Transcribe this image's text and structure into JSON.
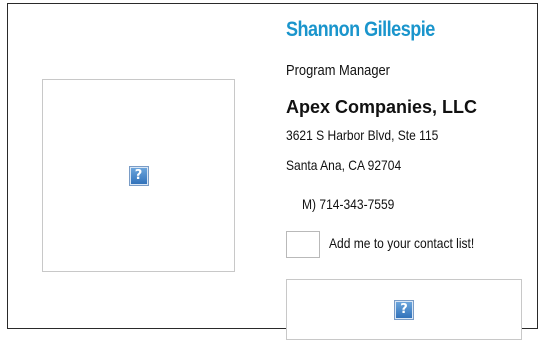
{
  "contact": {
    "name": "Shannon Gillespie",
    "title": "Program Manager",
    "company": "Apex Companies, LLC",
    "address_line1": "3621 S Harbor Blvd, Ste 115",
    "address_line2": "Santa Ana, CA 92704",
    "phone": "M) 714-343-7559"
  },
  "actions": {
    "add_contact_label": "Add me to your contact list!"
  },
  "images": {
    "photo_placeholder": "?",
    "banner_placeholder": "?"
  },
  "colors": {
    "name_accent": "#1a95cc",
    "border": "#2a2a2a"
  }
}
